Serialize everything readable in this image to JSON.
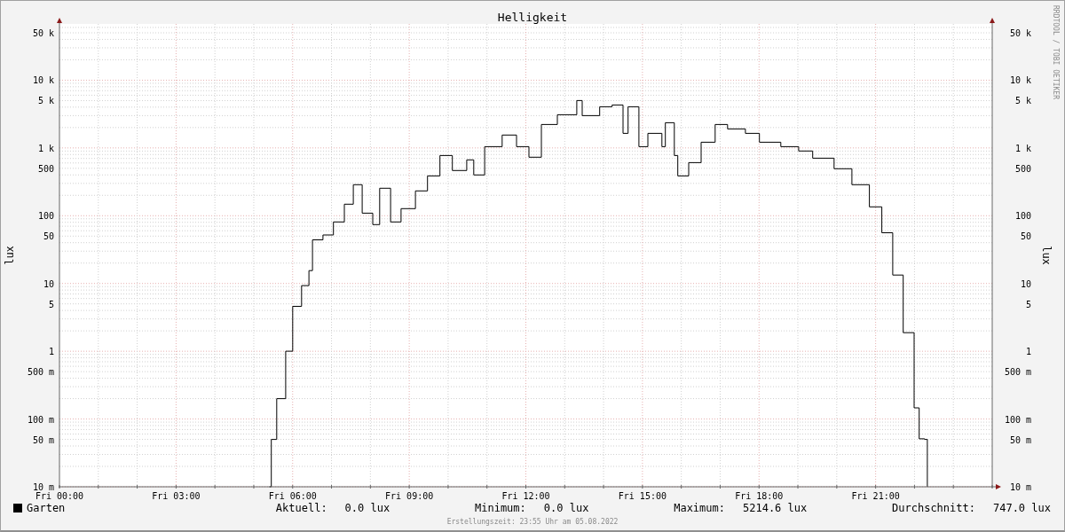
{
  "graph": {
    "title": "Helligkeit",
    "watermark": "RRDTOOL / TOBI OETIKER",
    "left_axis": {
      "label": "lux",
      "ticks": [
        "50 k",
        "10 k",
        "5 k",
        "1 k",
        "500",
        "100",
        "50",
        "10",
        "5",
        "1",
        "500 m",
        "100 m",
        "50 m",
        "10 m"
      ]
    },
    "right_axis": {
      "label": "lux",
      "ticks": [
        "50 k",
        "10 k",
        "5 k",
        "1 k",
        "500",
        "100",
        "50",
        "10",
        "5",
        "1",
        "500 m",
        "100 m",
        "50 m",
        "10 m"
      ]
    },
    "x_axis": {
      "ticks": [
        "Fri 00:00",
        "Fri 03:00",
        "Fri 06:00",
        "Fri 09:00",
        "Fri 12:00",
        "Fri 15:00",
        "Fri 18:00",
        "Fri 21:00"
      ]
    },
    "legend": {
      "series_label": "Garten",
      "stats": [
        {
          "label": "Aktuell:",
          "value": "0.0 lux"
        },
        {
          "label": "Minimum:",
          "value": "0.0 lux"
        },
        {
          "label": "Maximum:",
          "value": "5214.6 lux"
        },
        {
          "label": "Durchschnitt:",
          "value": "747.0 lux"
        }
      ]
    },
    "footer": "Erstellungszeit: 23:55 Uhr am 05.08.2022"
  }
}
